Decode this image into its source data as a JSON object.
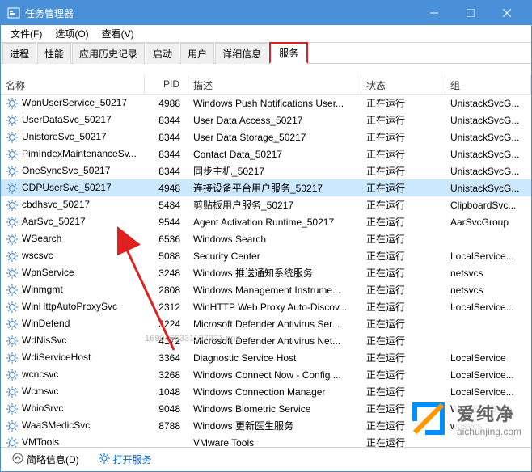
{
  "window": {
    "title": "任务管理器"
  },
  "menu": {
    "file": "文件(F)",
    "options": "选项(O)",
    "view": "查看(V)"
  },
  "tabs": {
    "processes": "进程",
    "performance": "性能",
    "app_history": "应用历史记录",
    "startup": "启动",
    "users": "用户",
    "details": "详细信息",
    "services": "服务"
  },
  "columns": {
    "name": "名称",
    "pid": "PID",
    "desc": "描述",
    "status": "状态",
    "group": "组"
  },
  "status_running": "正在运行",
  "services": [
    {
      "name": "WpnUserService_50217",
      "pid": "4988",
      "desc": "Windows Push Notifications User...",
      "group": "UnistackSvcG..."
    },
    {
      "name": "UserDataSvc_50217",
      "pid": "8344",
      "desc": "User Data Access_50217",
      "group": "UnistackSvcG..."
    },
    {
      "name": "UnistoreSvc_50217",
      "pid": "8344",
      "desc": "User Data Storage_50217",
      "group": "UnistackSvcG..."
    },
    {
      "name": "PimIndexMaintenanceSv...",
      "pid": "8344",
      "desc": "Contact Data_50217",
      "group": "UnistackSvcG..."
    },
    {
      "name": "OneSyncSvc_50217",
      "pid": "8344",
      "desc": "同步主机_50217",
      "group": "UnistackSvcG..."
    },
    {
      "name": "CDPUserSvc_50217",
      "pid": "4948",
      "desc": "连接设备平台用户服务_50217",
      "group": "UnistackSvcG...",
      "selected": true
    },
    {
      "name": "cbdhsvc_50217",
      "pid": "5484",
      "desc": "剪贴板用户服务_50217",
      "group": "ClipboardSvc..."
    },
    {
      "name": "AarSvc_50217",
      "pid": "9544",
      "desc": "Agent Activation Runtime_50217",
      "group": "AarSvcGroup"
    },
    {
      "name": "WSearch",
      "pid": "6536",
      "desc": "Windows Search",
      "group": ""
    },
    {
      "name": "wscsvc",
      "pid": "5088",
      "desc": "Security Center",
      "group": "LocalService..."
    },
    {
      "name": "WpnService",
      "pid": "3248",
      "desc": "Windows 推送通知系统服务",
      "group": "netsvcs"
    },
    {
      "name": "Winmgmt",
      "pid": "2808",
      "desc": "Windows Management Instrume...",
      "group": "netsvcs"
    },
    {
      "name": "WinHttpAutoProxySvc",
      "pid": "2312",
      "desc": "WinHTTP Web Proxy Auto-Discov...",
      "group": "LocalService..."
    },
    {
      "name": "WinDefend",
      "pid": "3224",
      "desc": "Microsoft Defender Antivirus Ser...",
      "group": ""
    },
    {
      "name": "WdNisSvc",
      "pid": "4172",
      "desc": "Microsoft Defender Antivirus Net...",
      "group": ""
    },
    {
      "name": "WdiServiceHost",
      "pid": "3364",
      "desc": "Diagnostic Service Host",
      "group": "LocalService"
    },
    {
      "name": "wcncsvc",
      "pid": "3268",
      "desc": "Windows Connect Now - Config ...",
      "group": "LocalService..."
    },
    {
      "name": "Wcmsvc",
      "pid": "1048",
      "desc": "Windows Connection Manager",
      "group": "LocalService..."
    },
    {
      "name": "WbioSrvc",
      "pid": "9048",
      "desc": "Windows Biometric Service",
      "group": "WbioSvcGro..."
    },
    {
      "name": "WaaSMedicSvc",
      "pid": "8788",
      "desc": "Windows 更新医生服务",
      "group": "wusvcs"
    },
    {
      "name": "VMTools",
      "pid": "",
      "desc": "VMware Tools",
      "group": ""
    }
  ],
  "statusbar": {
    "brief": "简略信息(D)",
    "open": "打开服务"
  },
  "watermark": "1690466331137921.png",
  "brand": {
    "cn": "爱纯净",
    "en": "aichunjing.com"
  }
}
